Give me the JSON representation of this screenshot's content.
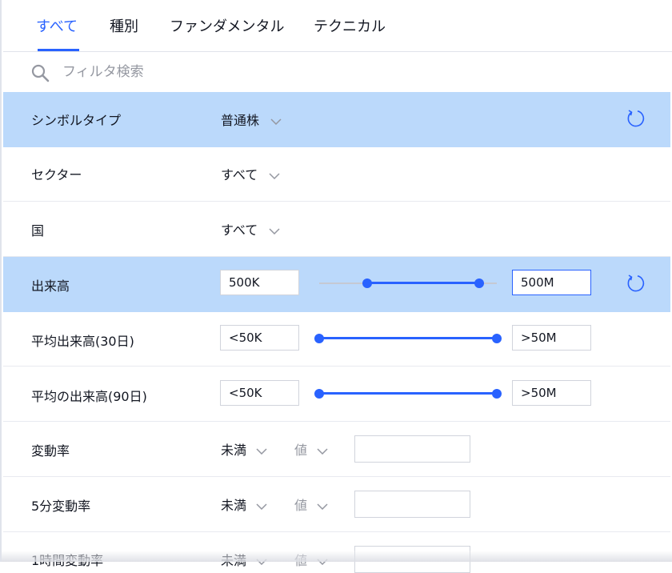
{
  "tabs": [
    {
      "label": "すべて",
      "active": true
    },
    {
      "label": "種別",
      "active": false
    },
    {
      "label": "ファンダメンタル",
      "active": false
    },
    {
      "label": "テクニカル",
      "active": false
    }
  ],
  "search": {
    "placeholder": "フィルタ検索",
    "value": ""
  },
  "rows": {
    "symbol_type": {
      "label": "シンボルタイプ",
      "value": "普通株",
      "highlighted": true
    },
    "sector": {
      "label": "セクター",
      "value": "すべて"
    },
    "country": {
      "label": "国",
      "value": "すべて"
    },
    "volume": {
      "label": "出来高",
      "min": "500K",
      "max": "500M",
      "slider_range": [
        0.27,
        0.9
      ],
      "highlighted": true
    },
    "avg_volume_30": {
      "label": "平均出来高(30日)",
      "min": "<50K",
      "max": ">50M",
      "slider_range": [
        0,
        1
      ]
    },
    "avg_volume_90": {
      "label": "平均の出来高(90日)",
      "min": "<50K",
      "max": ">50M",
      "slider_range": [
        0,
        1
      ]
    },
    "change": {
      "label": "変動率",
      "condition": "未満",
      "mode": "値",
      "value": ""
    },
    "change_5m": {
      "label": "5分変動率",
      "condition": "未満",
      "mode": "値",
      "value": ""
    },
    "change_1h": {
      "label": "1時間変動率",
      "condition": "未満",
      "mode": "値",
      "value": ""
    }
  },
  "colors": {
    "accent": "#2962ff",
    "highlight": "#bbd9fb",
    "muted": "#9598a1"
  },
  "icons": [
    "search-icon",
    "chevron-down-icon",
    "reset-icon"
  ]
}
